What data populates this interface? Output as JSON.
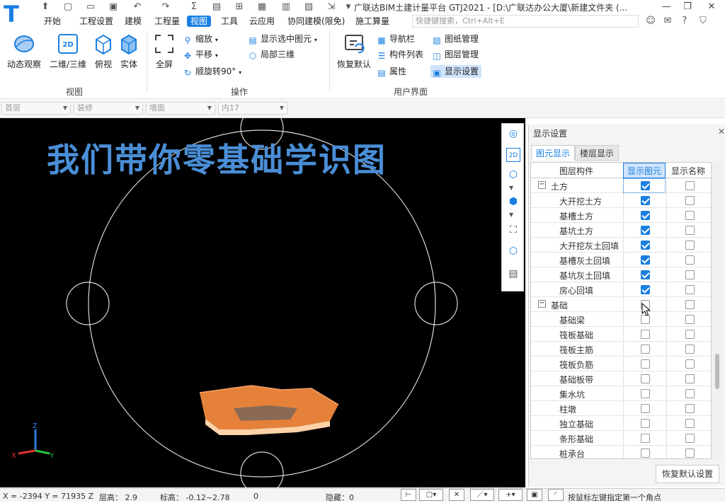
{
  "app": {
    "title": "广联达BIM土建计量平台 GTJ2021 - [D:\\广联达办公大厦\\新建文件夹 (...",
    "logo": "T"
  },
  "quick_access": {
    "icons": [
      "open-icon",
      "new-icon",
      "folder-icon",
      "save-icon",
      "undo-icon",
      "redo-icon",
      "sum-icon",
      "calc-icon",
      "grid-icon",
      "layers-icon",
      "export-icon",
      "chevron-down-icon"
    ]
  },
  "menu": {
    "items": [
      "开始",
      "工程设置",
      "建模",
      "工程量",
      "视图",
      "工具",
      "云应用",
      "协同建模(限免)",
      "施工算量"
    ],
    "active_index": 4,
    "search_placeholder": "快捷键搜索，Ctrl+Alt+E",
    "right_icons": [
      "user-icon",
      "chat-icon",
      "help-icon",
      "shirt-icon"
    ],
    "help_label": "?"
  },
  "ribbon": {
    "view_group": {
      "label": "视图",
      "buttons": [
        "动态观察",
        "二维/三维",
        "俯视",
        "实体"
      ],
      "badge_2d": "2D"
    },
    "operate_group": {
      "label": "操作",
      "fullscreen": "全屏",
      "zoom": "缩放",
      "pan": "平移",
      "rotate": "顺旋转90°",
      "show_selected": "显示选中图元",
      "local_3d": "局部三维"
    },
    "ui_group": {
      "label": "用户界面",
      "restore": "恢复默认",
      "nav": "导航栏",
      "comp_list": "构件列表",
      "props": "属性",
      "drawing_mgmt": "图纸管理",
      "layer_mgmt": "图层管理",
      "display_settings": "显示设置"
    }
  },
  "floorbar": {
    "floor": "首层",
    "category": "装修",
    "component": "墙面",
    "item": "内17"
  },
  "viewport": {
    "banner": "我们带你零基础学识图",
    "axis_labels": {
      "z": "Z",
      "x": "X",
      "y": "Y"
    }
  },
  "panel": {
    "title": "显示设置",
    "tabs": [
      "图元显示",
      "楼层显示"
    ],
    "active_tab": 0,
    "headers": [
      "图层构件",
      "显示图元",
      "显示名称"
    ],
    "rows": [
      {
        "name": "土方",
        "group": true,
        "show": true,
        "name_show": false
      },
      {
        "name": "大开挖土方",
        "group": false,
        "show": true,
        "name_show": false
      },
      {
        "name": "基槽土方",
        "group": false,
        "show": true,
        "name_show": false
      },
      {
        "name": "基坑土方",
        "group": false,
        "show": true,
        "name_show": false
      },
      {
        "name": "大开挖灰土回填",
        "group": false,
        "show": true,
        "name_show": false
      },
      {
        "name": "基槽灰土回填",
        "group": false,
        "show": true,
        "name_show": false
      },
      {
        "name": "基坑灰土回填",
        "group": false,
        "show": true,
        "name_show": false
      },
      {
        "name": "房心回填",
        "group": false,
        "show": true,
        "name_show": false
      },
      {
        "name": "基础",
        "group": true,
        "show": false,
        "name_show": false
      },
      {
        "name": "基础梁",
        "group": false,
        "show": false,
        "name_show": false
      },
      {
        "name": "筏板基础",
        "group": false,
        "show": false,
        "name_show": false
      },
      {
        "name": "筏板主筋",
        "group": false,
        "show": false,
        "name_show": false
      },
      {
        "name": "筏板负筋",
        "group": false,
        "show": false,
        "name_show": false
      },
      {
        "name": "基础板带",
        "group": false,
        "show": false,
        "name_show": false
      },
      {
        "name": "集水坑",
        "group": false,
        "show": false,
        "name_show": false
      },
      {
        "name": "柱墩",
        "group": false,
        "show": false,
        "name_show": false
      },
      {
        "name": "独立基础",
        "group": false,
        "show": false,
        "name_show": false
      },
      {
        "name": "条形基础",
        "group": false,
        "show": false,
        "name_show": false
      },
      {
        "name": "桩承台",
        "group": false,
        "show": false,
        "name_show": false
      }
    ],
    "collapse_symbol": "−",
    "reset_button": "恢复默认设置"
  },
  "status": {
    "coords": "X = -2394 Y = 71935 Z",
    "floor_height": "层高：  2.9",
    "elevation": "标高：  -0.12~2.78",
    "count": "0",
    "hidden": "隐藏：0",
    "hint": "按鼠标左键指定第一个角点"
  },
  "colors": {
    "accent": "#1a7fe0",
    "banner": "#4a8ed6",
    "solid": "#e6813a",
    "viewport_bg": "#000000"
  }
}
